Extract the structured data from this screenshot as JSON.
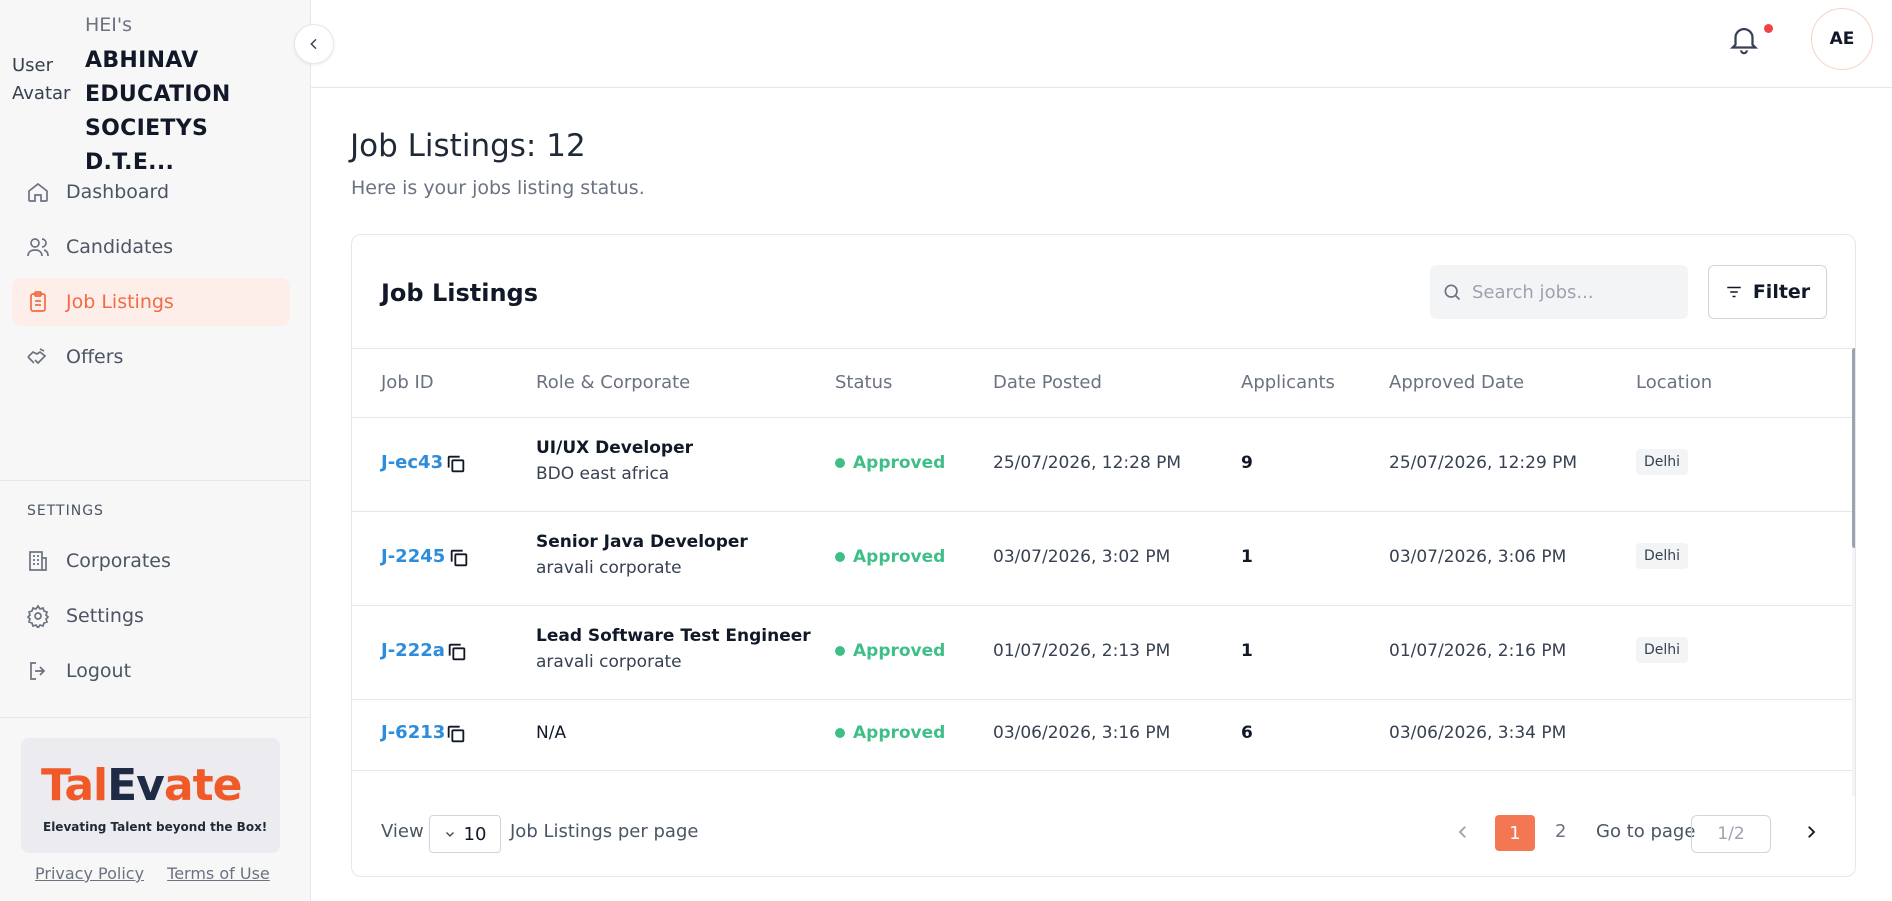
{
  "sidebar": {
    "avatar_alt": "User Avatar",
    "hei_label": "HEI's",
    "org_name": "ABHINAV EDUCATION SOCIETYS D.T.E...",
    "nav": [
      {
        "label": "Dashboard",
        "icon": "home-icon"
      },
      {
        "label": "Candidates",
        "icon": "users-icon"
      },
      {
        "label": "Job Listings",
        "icon": "clipboard-icon",
        "active": true
      },
      {
        "label": "Offers",
        "icon": "handshake-icon"
      }
    ],
    "settings_label": "SETTINGS",
    "settings_nav": [
      {
        "label": "Corporates",
        "icon": "building-icon"
      },
      {
        "label": "Settings",
        "icon": "gear-icon"
      },
      {
        "label": "Logout",
        "icon": "logout-icon"
      }
    ],
    "logo": {
      "part1": "Tal",
      "part2": "Ev",
      "part3": "ate",
      "tagline": "Elevating Talent beyond the Box!"
    },
    "privacy": "Privacy Policy",
    "terms": "Terms of Use"
  },
  "topbar": {
    "user_initials": "AE"
  },
  "page": {
    "title": "Job Listings: 12",
    "subtitle": "Here is your jobs listing status."
  },
  "card": {
    "title": "Job Listings",
    "search_placeholder": "Search jobs...",
    "filter_label": "Filter",
    "columns": [
      "Job ID",
      "Role & Corporate",
      "Status",
      "Date Posted",
      "Applicants",
      "Approved Date",
      "Location"
    ],
    "rows": [
      {
        "id": "J-ec43",
        "role": "UI/UX Developer",
        "corporate": "BDO east africa",
        "status": "Approved",
        "posted": "25/07/2026, 12:28 PM",
        "applicants": "9",
        "approved": "25/07/2026, 12:29 PM",
        "location": "Delhi"
      },
      {
        "id": "J-2245",
        "role": "Senior Java Developer",
        "corporate": "aravali corporate",
        "status": "Approved",
        "posted": "03/07/2026, 3:02 PM",
        "applicants": "1",
        "approved": "03/07/2026, 3:06 PM",
        "location": "Delhi"
      },
      {
        "id": "J-222a",
        "role": "Lead Software Test Engineer",
        "corporate": "aravali corporate",
        "status": "Approved",
        "posted": "01/07/2026, 2:13 PM",
        "applicants": "1",
        "approved": "01/07/2026, 2:16 PM",
        "location": "Delhi"
      },
      {
        "id": "J-6213",
        "role": "N/A",
        "corporate": "",
        "status": "Approved",
        "posted": "03/06/2026, 3:16 PM",
        "applicants": "6",
        "approved": "03/06/2026, 3:34 PM",
        "location": ""
      }
    ],
    "footer": {
      "view_label": "View",
      "per_page_value": "10",
      "per_page_suffix": "Job Listings per page",
      "page_1": "1",
      "page_2": "2",
      "goto_label": "Go to page",
      "goto_placeholder": "1/2"
    }
  },
  "colors": {
    "accent": "#f26b46",
    "link": "#2d8cdb",
    "approved": "#3fbf87"
  }
}
